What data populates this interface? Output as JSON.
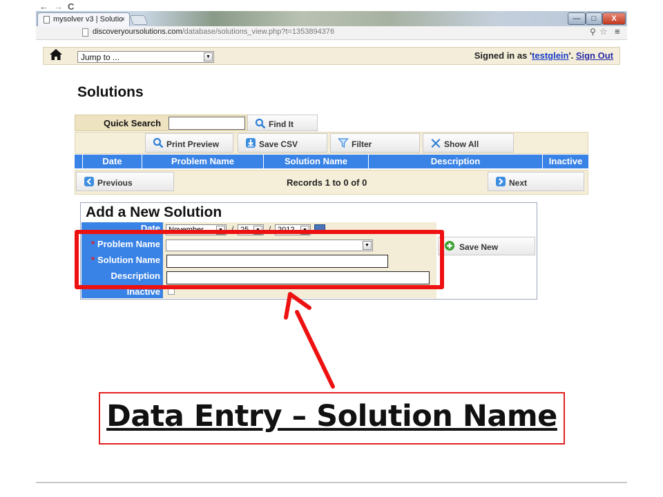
{
  "browser": {
    "tab_title": "mysolver v3 | Solutio",
    "tab_close": "×",
    "address_host": "discoveryoursolutions.com",
    "address_path": "/database/solutions_view.php?t=1353894376",
    "nav_back": "←",
    "nav_forward": "→",
    "nav_reload": "C",
    "min_label": "—",
    "max_label": "□",
    "close_label": "X"
  },
  "header": {
    "jump_to": "Jump to ...",
    "signed_prefix": "Signed in as '",
    "username": "testglein",
    "signed_suffix": "'. ",
    "sign_out": "Sign Out"
  },
  "solutions": {
    "title": "Solutions",
    "quick_search_label": "Quick Search",
    "quick_search_value": "",
    "find_it": "Find It",
    "print_preview": "Print Preview",
    "save_csv": "Save CSV",
    "filter": "Filter",
    "show_all": "Show All",
    "columns": [
      "Date",
      "Problem Name",
      "Solution Name",
      "Description",
      "Inactive"
    ],
    "previous": "Previous",
    "records": "Records 1 to 0 of 0",
    "next": "Next"
  },
  "form": {
    "title": "Add a New Solution",
    "labels": {
      "date": "Date",
      "problem_name": "Problem Name",
      "solution_name": "Solution Name",
      "description": "Description",
      "inactive": "Inactive"
    },
    "required_mark": "*",
    "date_month": "November",
    "date_day": "25",
    "date_year": "2012",
    "date_sep": "/",
    "problem_name_value": "",
    "solution_name_value": "",
    "description_value": "",
    "save_new": "Save New"
  },
  "annotation": {
    "caption": "Data Entry – Solution Name",
    "highlight_color": "#ee1111"
  },
  "colors": {
    "header_blue": "#3a83e6",
    "panel_beige": "#f3ecd6",
    "link_blue": "#1a3cc8"
  }
}
